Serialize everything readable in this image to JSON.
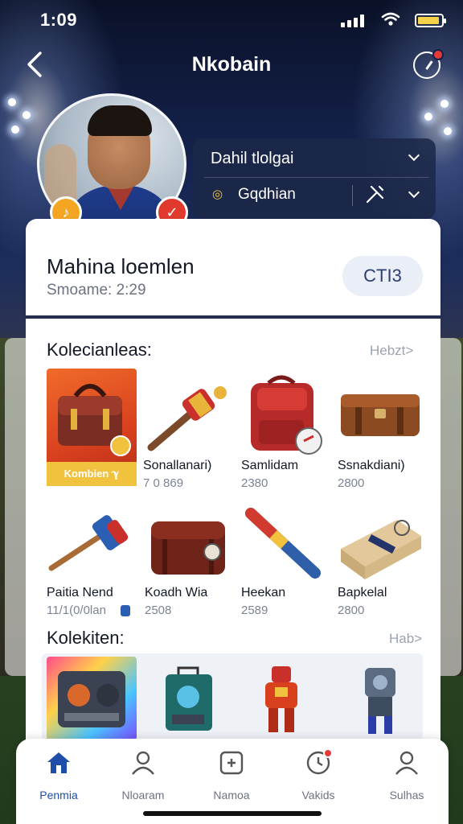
{
  "status_bar": {
    "time": "1:09"
  },
  "nav": {
    "title": "Nkobain"
  },
  "dropdowns": {
    "first": "Dahil tlolgai",
    "second": "Gqdhian"
  },
  "profile": {
    "name": "Mahina loemlen",
    "subtitle": "Smoame: 2:29",
    "button": "CTI3"
  },
  "section1": {
    "title": "Kolecianleas:",
    "link": "Hebzt>",
    "featured_banner": "Kombien ℽ",
    "items": [
      {
        "label": "Sonallanari)",
        "value": "7 0 869"
      },
      {
        "label": "Samlidam",
        "value": "2380"
      },
      {
        "label": "Ssnakdiani)",
        "value": "2800"
      },
      {
        "label": "Paitia Nend",
        "value": "11/1(0/0lan"
      },
      {
        "label": "Koadh Wia",
        "value": "2508"
      },
      {
        "label": "Heekan",
        "value": "2589"
      },
      {
        "label": "Bapkelal",
        "value": "2800"
      }
    ]
  },
  "section2": {
    "title": "Kolekiten:",
    "link": "Hab>"
  },
  "tabs": [
    {
      "label": "Penmia",
      "icon": "home-icon",
      "active": true
    },
    {
      "label": "Nloaram",
      "icon": "person-icon",
      "active": false
    },
    {
      "label": "Namoa",
      "icon": "calculator-icon",
      "active": false
    },
    {
      "label": "Vakids",
      "icon": "clock-icon",
      "active": false
    },
    {
      "label": "Sulhas",
      "icon": "person-icon",
      "active": false
    }
  ],
  "colors": {
    "accent": "#1f4ea8",
    "badge_red": "#e53935",
    "badge_orange": "#f4a623"
  }
}
